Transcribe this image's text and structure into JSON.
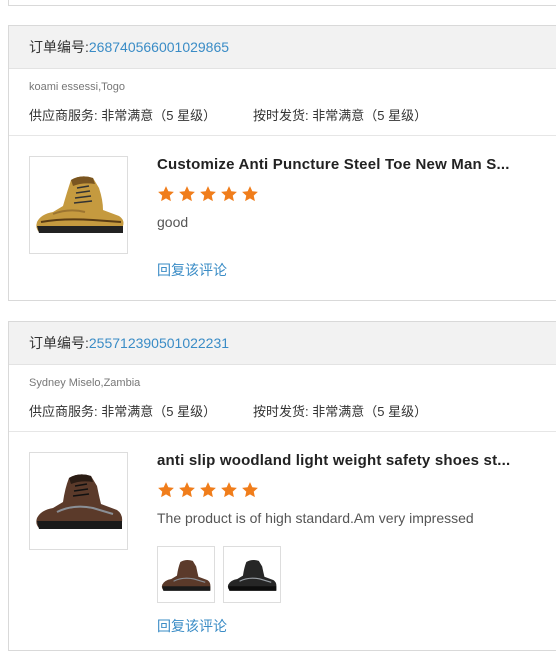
{
  "orders": [
    {
      "order_label": "订单编号:",
      "order_number": "268740566001029865",
      "buyer": "koami essessi,Togo",
      "service_rating": "供应商服务: 非常满意（5 星级）",
      "shipping_rating": "按时发货: 非常满意（5 星级）",
      "product_title": "Customize Anti Puncture Steel Toe New Man S...",
      "stars": 5,
      "review": "good",
      "reply_label": "回复该评论"
    },
    {
      "order_label": "订单编号:",
      "order_number": "255712390501022231",
      "buyer": "Sydney Miselo,Zambia",
      "service_rating": "供应商服务: 非常满意（5 星级）",
      "shipping_rating": "按时发货: 非常满意（5 星级）",
      "product_title": "anti slip woodland light weight safety shoes st...",
      "stars": 5,
      "review": "The product is of high standard.Am very impressed",
      "reply_label": "回复该评论"
    }
  ],
  "colors": {
    "link": "#3a8cc6",
    "star": "#f07d1b",
    "header_bg": "#f2f2f2",
    "border": "#d9d9d9"
  },
  "icons": {
    "star": "star-icon",
    "boot_tan": "tan-work-boot-icon",
    "boot_brown": "brown-safety-boot-icon",
    "boot_black": "black-safety-boot-icon"
  }
}
